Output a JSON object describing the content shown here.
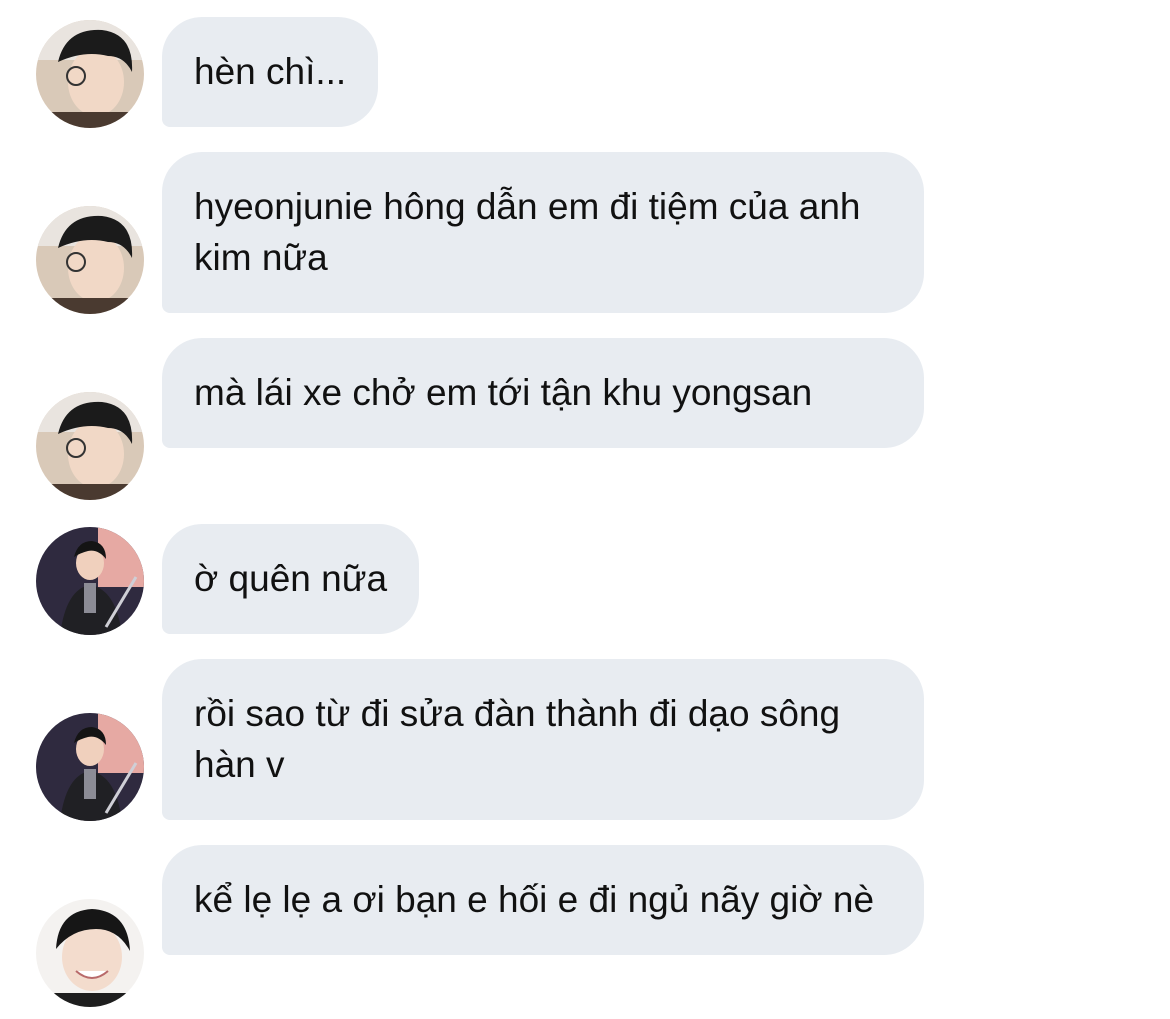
{
  "messages": [
    {
      "sender": "avatar-a",
      "text": "hèn chì..."
    },
    {
      "sender": "avatar-a",
      "text": "hyeonjunie hông dẫn em đi tiệm của anh kim nữa"
    },
    {
      "sender": "avatar-a",
      "text": "mà lái xe chở em tới tận khu yongsan"
    },
    {
      "sender": "avatar-b",
      "text": "ờ quên nữa"
    },
    {
      "sender": "avatar-b",
      "text": "rồi sao từ đi sửa đàn thành đi dạo sông hàn v"
    },
    {
      "sender": "avatar-c",
      "text": "kể lẹ lẹ a ơi bạn e hối e đi ngủ nãy giờ nè"
    }
  ],
  "colors": {
    "bubble_bg": "#e8ecf1",
    "text": "#111111",
    "background": "#ffffff"
  }
}
